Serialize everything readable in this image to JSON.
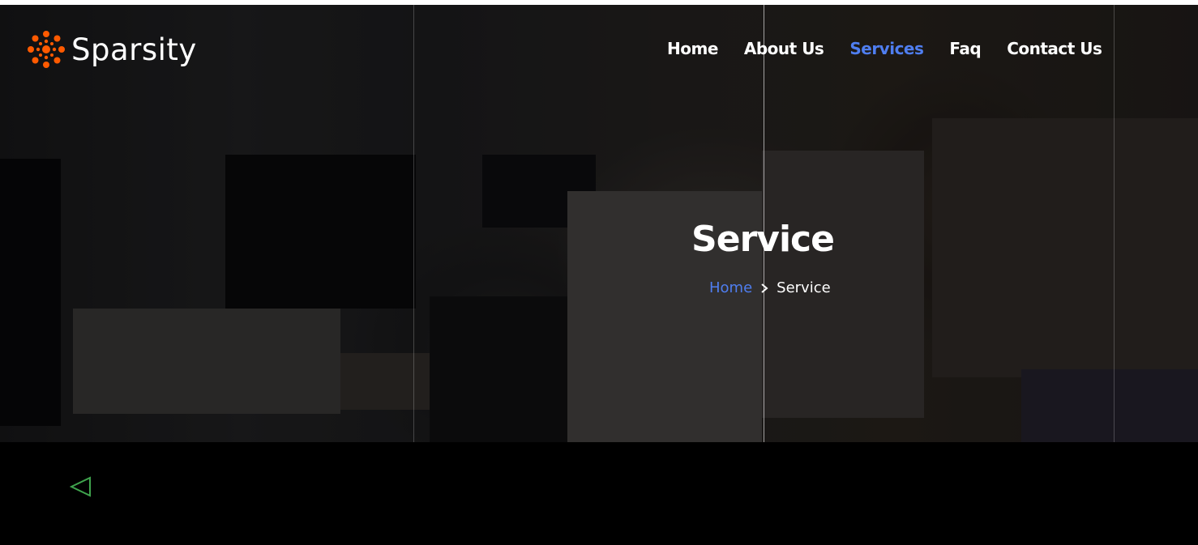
{
  "brand": {
    "name": "Sparsity",
    "accent_color": "#ff5a00",
    "logo_icon": "starburst-logo-icon"
  },
  "nav": {
    "items": [
      {
        "label": "Home",
        "active": false
      },
      {
        "label": "About Us",
        "active": false
      },
      {
        "label": "Services",
        "active": true
      },
      {
        "label": "Faq",
        "active": false
      },
      {
        "label": "Contact Us",
        "active": false
      }
    ],
    "active_color": "#4f7ef0"
  },
  "hero": {
    "title": "Service",
    "breadcrumb": {
      "home": "Home",
      "separator_icon": "chevron-right-icon",
      "current": "Service"
    }
  },
  "footer_band": {
    "icon": "triangle-left-icon",
    "icon_color": "#3fa34d"
  }
}
